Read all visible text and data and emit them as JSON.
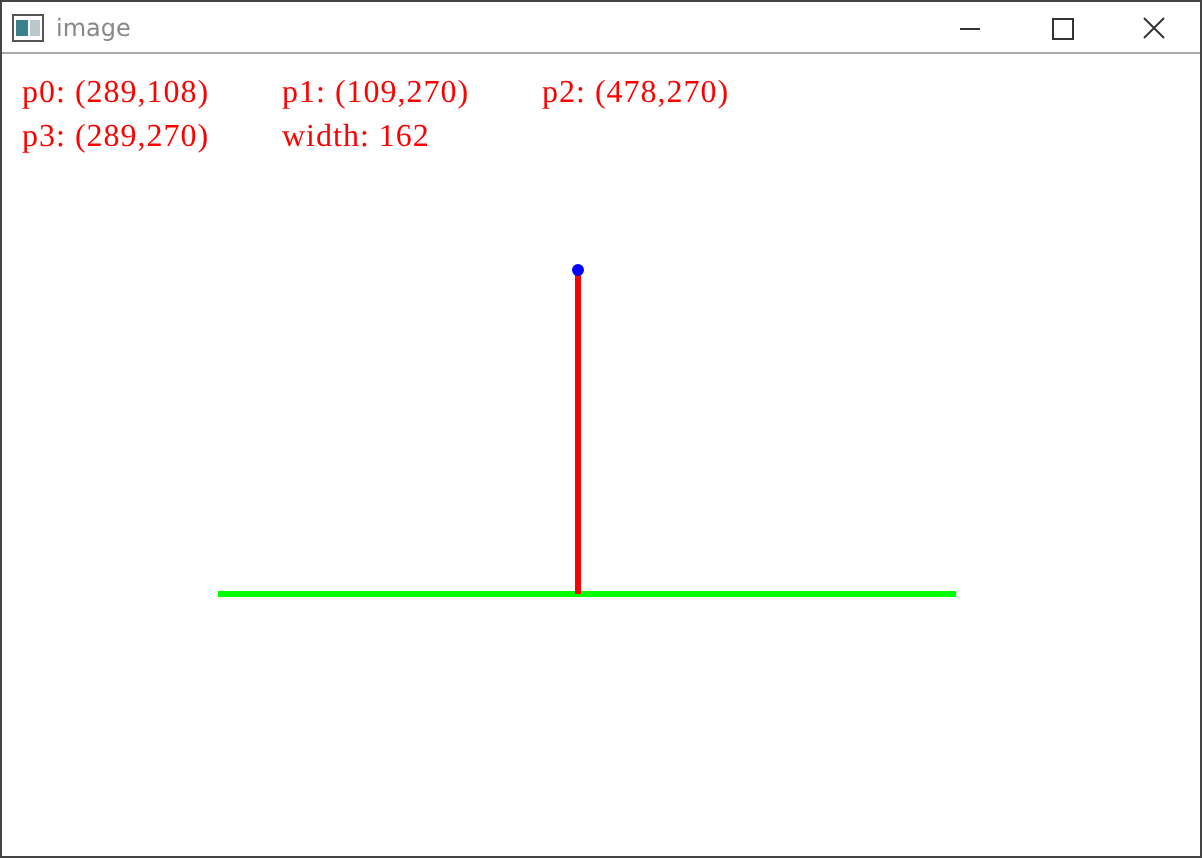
{
  "window": {
    "title": "image"
  },
  "labels": [
    [
      "p0: (289,108)",
      "p1: (109,270)",
      "p2: (478,270)"
    ],
    [
      "p3: (289,270)",
      "width: 162"
    ]
  ]
}
